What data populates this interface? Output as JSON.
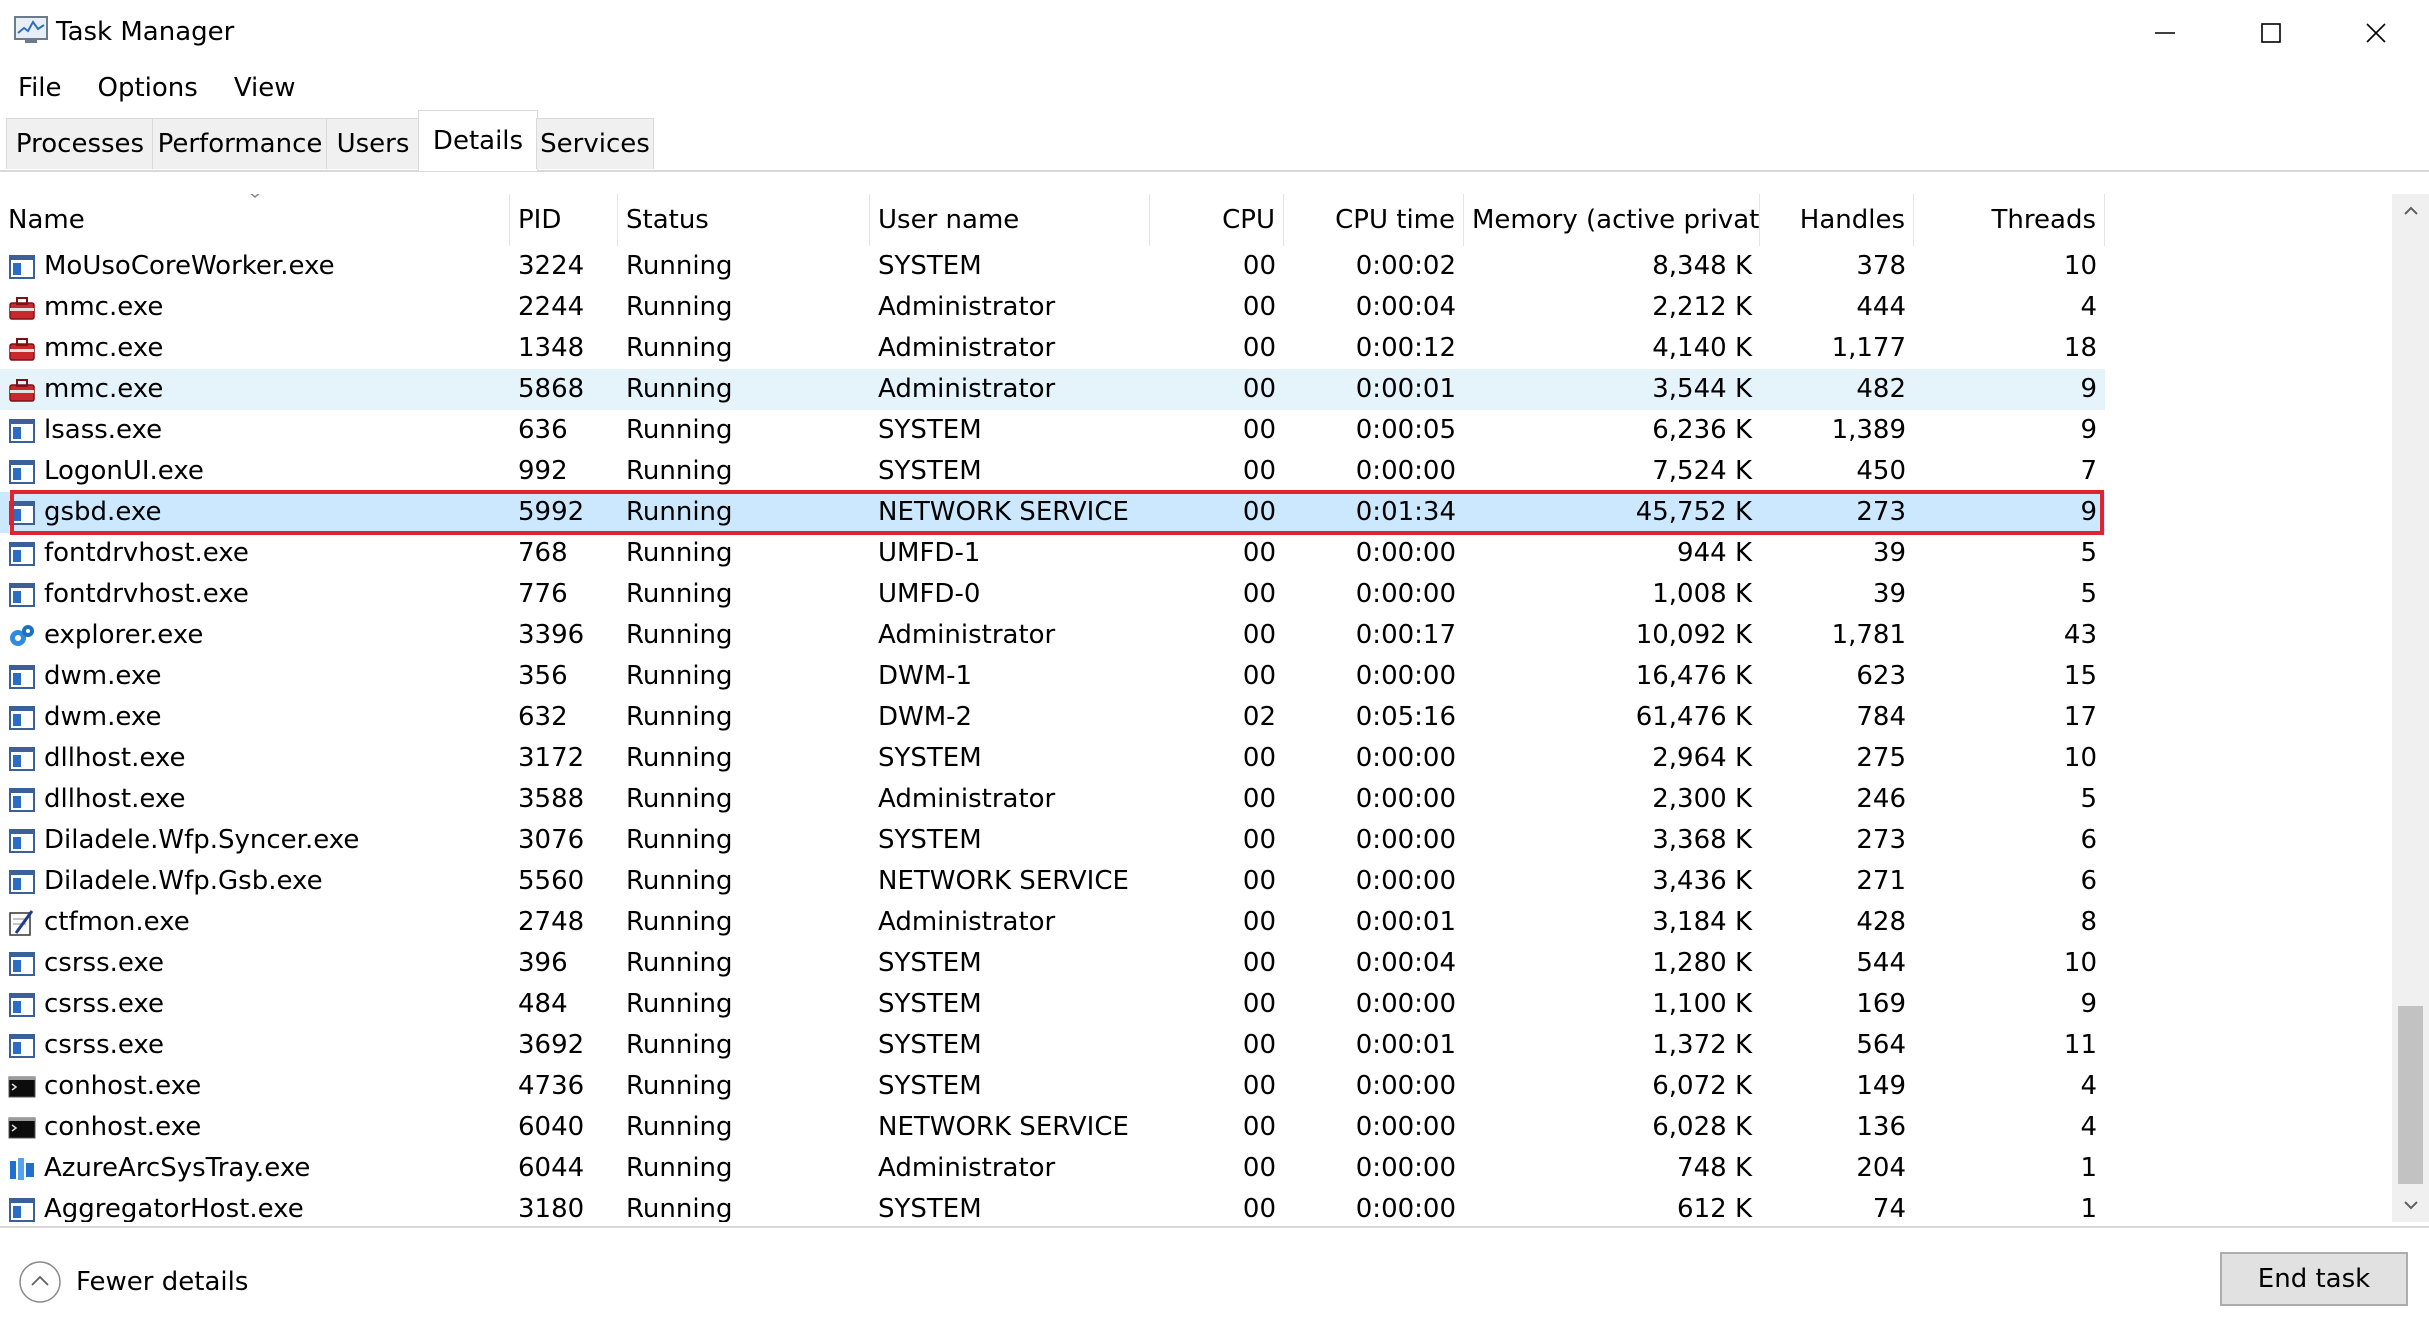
{
  "window": {
    "title": "Task Manager",
    "icon": "task-manager-icon"
  },
  "menu": [
    {
      "label": "File"
    },
    {
      "label": "Options"
    },
    {
      "label": "View"
    }
  ],
  "tabs": [
    {
      "label": "Processes"
    },
    {
      "label": "Performance"
    },
    {
      "label": "Users"
    },
    {
      "label": "Details",
      "active": true
    },
    {
      "label": "Services"
    }
  ],
  "columns": [
    "Name",
    "PID",
    "Status",
    "User name",
    "CPU",
    "CPU time",
    "Memory (active privat...",
    "Handles",
    "Threads"
  ],
  "sort_column": "Name",
  "rows": [
    {
      "icon": "app-window-icon",
      "name": "MoUsoCoreWorker.exe",
      "pid": "3224",
      "status": "Running",
      "user": "SYSTEM",
      "cpu": "00",
      "cpu_time": "0:00:02",
      "memory": "8,348 K",
      "handles": "378",
      "threads": "10"
    },
    {
      "icon": "toolbox-icon",
      "name": "mmc.exe",
      "pid": "2244",
      "status": "Running",
      "user": "Administrator",
      "cpu": "00",
      "cpu_time": "0:00:04",
      "memory": "2,212 K",
      "handles": "444",
      "threads": "4"
    },
    {
      "icon": "toolbox-icon",
      "name": "mmc.exe",
      "pid": "1348",
      "status": "Running",
      "user": "Administrator",
      "cpu": "00",
      "cpu_time": "0:00:12",
      "memory": "4,140 K",
      "handles": "1,177",
      "threads": "18"
    },
    {
      "icon": "toolbox-icon",
      "name": "mmc.exe",
      "pid": "5868",
      "status": "Running",
      "user": "Administrator",
      "cpu": "00",
      "cpu_time": "0:00:01",
      "memory": "3,544 K",
      "handles": "482",
      "threads": "9",
      "state": "hover"
    },
    {
      "icon": "app-window-icon",
      "name": "lsass.exe",
      "pid": "636",
      "status": "Running",
      "user": "SYSTEM",
      "cpu": "00",
      "cpu_time": "0:00:05",
      "memory": "6,236 K",
      "handles": "1,389",
      "threads": "9"
    },
    {
      "icon": "app-window-icon",
      "name": "LogonUI.exe",
      "pid": "992",
      "status": "Running",
      "user": "SYSTEM",
      "cpu": "00",
      "cpu_time": "0:00:00",
      "memory": "7,524 K",
      "handles": "450",
      "threads": "7"
    },
    {
      "icon": "app-window-icon",
      "name": "gsbd.exe",
      "pid": "5992",
      "status": "Running",
      "user": "NETWORK SERVICE",
      "cpu": "00",
      "cpu_time": "0:01:34",
      "memory": "45,752 K",
      "handles": "273",
      "threads": "9",
      "state": "selected"
    },
    {
      "icon": "app-window-icon",
      "name": "fontdrvhost.exe",
      "pid": "768",
      "status": "Running",
      "user": "UMFD-1",
      "cpu": "00",
      "cpu_time": "0:00:00",
      "memory": "944 K",
      "handles": "39",
      "threads": "5"
    },
    {
      "icon": "app-window-icon",
      "name": "fontdrvhost.exe",
      "pid": "776",
      "status": "Running",
      "user": "UMFD-0",
      "cpu": "00",
      "cpu_time": "0:00:00",
      "memory": "1,008 K",
      "handles": "39",
      "threads": "5"
    },
    {
      "icon": "explorer-gears-icon",
      "name": "explorer.exe",
      "pid": "3396",
      "status": "Running",
      "user": "Administrator",
      "cpu": "00",
      "cpu_time": "0:00:17",
      "memory": "10,092 K",
      "handles": "1,781",
      "threads": "43"
    },
    {
      "icon": "app-window-icon",
      "name": "dwm.exe",
      "pid": "356",
      "status": "Running",
      "user": "DWM-1",
      "cpu": "00",
      "cpu_time": "0:00:00",
      "memory": "16,476 K",
      "handles": "623",
      "threads": "15"
    },
    {
      "icon": "app-window-icon",
      "name": "dwm.exe",
      "pid": "632",
      "status": "Running",
      "user": "DWM-2",
      "cpu": "02",
      "cpu_time": "0:05:16",
      "memory": "61,476 K",
      "handles": "784",
      "threads": "17"
    },
    {
      "icon": "app-window-icon",
      "name": "dllhost.exe",
      "pid": "3172",
      "status": "Running",
      "user": "SYSTEM",
      "cpu": "00",
      "cpu_time": "0:00:00",
      "memory": "2,964 K",
      "handles": "275",
      "threads": "10"
    },
    {
      "icon": "app-window-icon",
      "name": "dllhost.exe",
      "pid": "3588",
      "status": "Running",
      "user": "Administrator",
      "cpu": "00",
      "cpu_time": "0:00:00",
      "memory": "2,300 K",
      "handles": "246",
      "threads": "5"
    },
    {
      "icon": "app-window-icon",
      "name": "Diladele.Wfp.Syncer.exe",
      "pid": "3076",
      "status": "Running",
      "user": "SYSTEM",
      "cpu": "00",
      "cpu_time": "0:00:00",
      "memory": "3,368 K",
      "handles": "273",
      "threads": "6"
    },
    {
      "icon": "app-window-icon",
      "name": "Diladele.Wfp.Gsb.exe",
      "pid": "5560",
      "status": "Running",
      "user": "NETWORK SERVICE",
      "cpu": "00",
      "cpu_time": "0:00:00",
      "memory": "3,436 K",
      "handles": "271",
      "threads": "6"
    },
    {
      "icon": "ctfmon-pen-icon",
      "name": "ctfmon.exe",
      "pid": "2748",
      "status": "Running",
      "user": "Administrator",
      "cpu": "00",
      "cpu_time": "0:00:01",
      "memory": "3,184 K",
      "handles": "428",
      "threads": "8"
    },
    {
      "icon": "app-window-icon",
      "name": "csrss.exe",
      "pid": "396",
      "status": "Running",
      "user": "SYSTEM",
      "cpu": "00",
      "cpu_time": "0:00:04",
      "memory": "1,280 K",
      "handles": "544",
      "threads": "10"
    },
    {
      "icon": "app-window-icon",
      "name": "csrss.exe",
      "pid": "484",
      "status": "Running",
      "user": "SYSTEM",
      "cpu": "00",
      "cpu_time": "0:00:00",
      "memory": "1,100 K",
      "handles": "169",
      "threads": "9"
    },
    {
      "icon": "app-window-icon",
      "name": "csrss.exe",
      "pid": "3692",
      "status": "Running",
      "user": "SYSTEM",
      "cpu": "00",
      "cpu_time": "0:00:01",
      "memory": "1,372 K",
      "handles": "564",
      "threads": "11"
    },
    {
      "icon": "console-icon",
      "name": "conhost.exe",
      "pid": "4736",
      "status": "Running",
      "user": "SYSTEM",
      "cpu": "00",
      "cpu_time": "0:00:00",
      "memory": "6,072 K",
      "handles": "149",
      "threads": "4"
    },
    {
      "icon": "console-icon",
      "name": "conhost.exe",
      "pid": "6040",
      "status": "Running",
      "user": "NETWORK SERVICE",
      "cpu": "00",
      "cpu_time": "0:00:00",
      "memory": "6,028 K",
      "handles": "136",
      "threads": "4"
    },
    {
      "icon": "azure-arc-icon",
      "name": "AzureArcSysTray.exe",
      "pid": "6044",
      "status": "Running",
      "user": "Administrator",
      "cpu": "00",
      "cpu_time": "0:00:00",
      "memory": "748 K",
      "handles": "204",
      "threads": "1"
    },
    {
      "icon": "app-window-icon",
      "name": "AggregatorHost.exe",
      "pid": "3180",
      "status": "Running",
      "user": "SYSTEM",
      "cpu": "00",
      "cpu_time": "0:00:00",
      "memory": "612 K",
      "handles": "74",
      "threads": "1"
    }
  ],
  "footer": {
    "fewer_details": "Fewer details",
    "end_task": "End task"
  },
  "colors": {
    "selected_row": "#cce8ff",
    "hover_row": "#e5f3fb",
    "annotation_box": "#e0242e"
  }
}
